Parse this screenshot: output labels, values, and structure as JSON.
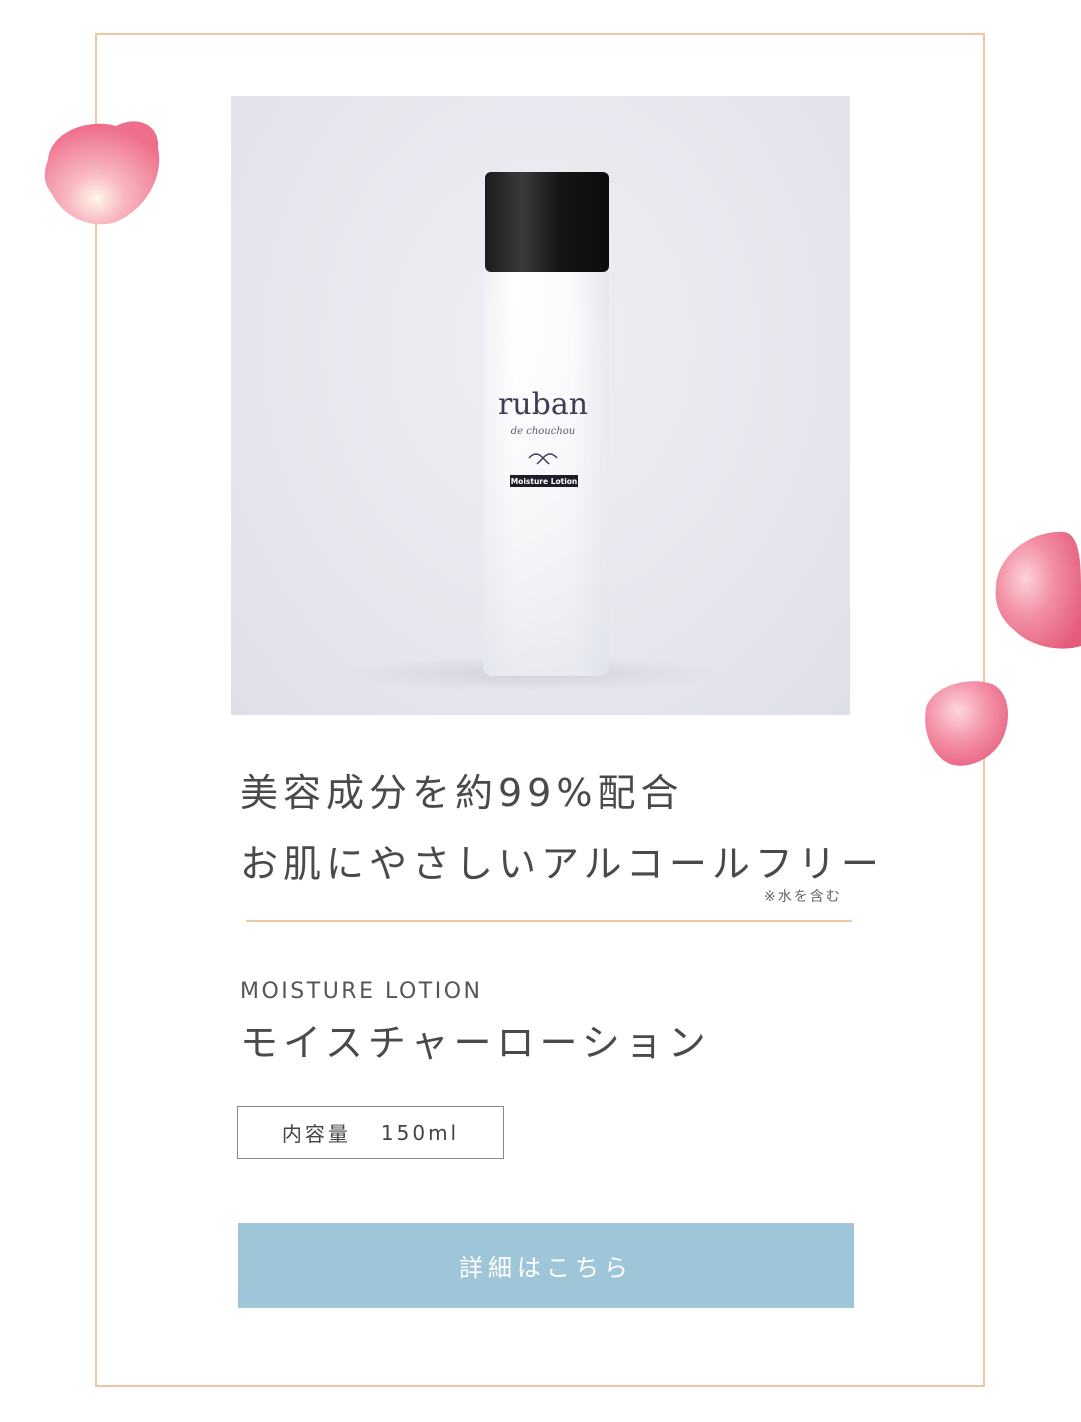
{
  "product_photo": {
    "brand": "ruban",
    "sub_brand": "de chouchou",
    "label": "Moisture Lotion"
  },
  "headline": {
    "line1": "美容成分を約99%配合",
    "line2": "お肌にやさしいアルコールフリー",
    "note": "※水を含む"
  },
  "product": {
    "name_en": "MOISTURE LOTION",
    "name_ja": "モイスチャーローション",
    "volume_label": "内容量",
    "volume_value": "150ml"
  },
  "cta": {
    "label": "詳細はこちら"
  },
  "colors": {
    "frame": "#ecc8a4",
    "button": "#9fc5d8",
    "petal": "#f07e97"
  }
}
